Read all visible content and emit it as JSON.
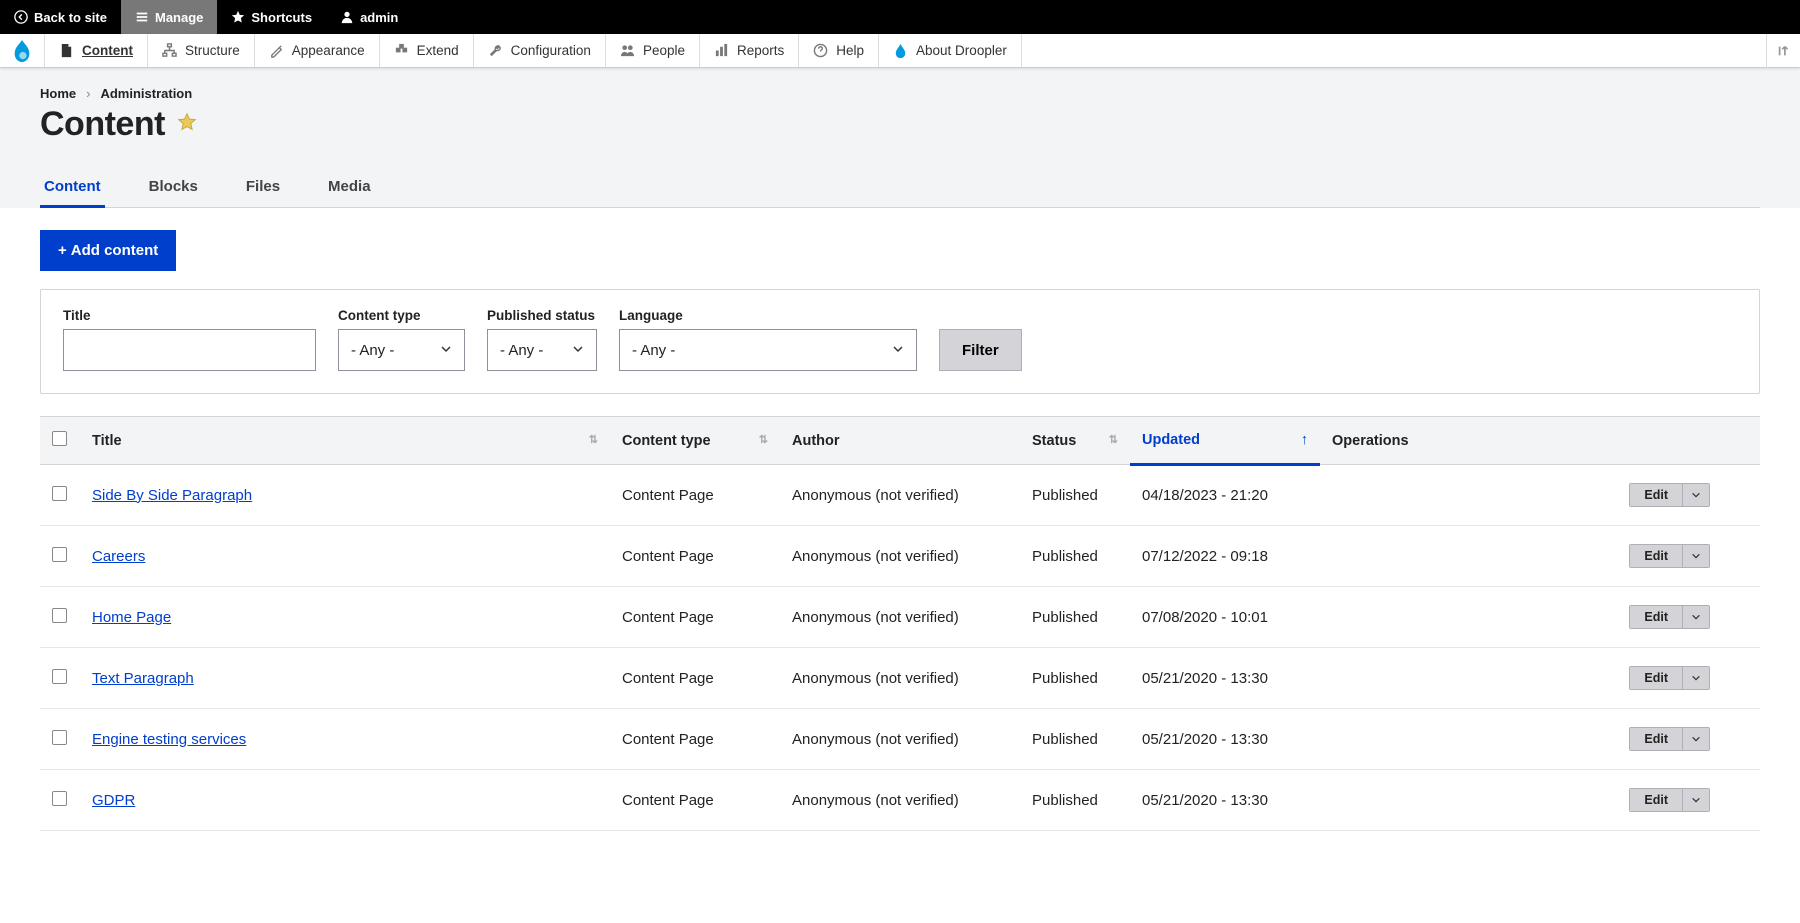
{
  "toolbar_top": {
    "back": "Back to site",
    "manage": "Manage",
    "shortcuts": "Shortcuts",
    "user": "admin"
  },
  "admin_menu": {
    "items": [
      {
        "label": "Content"
      },
      {
        "label": "Structure"
      },
      {
        "label": "Appearance"
      },
      {
        "label": "Extend"
      },
      {
        "label": "Configuration"
      },
      {
        "label": "People"
      },
      {
        "label": "Reports"
      },
      {
        "label": "Help"
      },
      {
        "label": "About Droopler"
      }
    ]
  },
  "breadcrumb": {
    "home": "Home",
    "admin": "Administration"
  },
  "page_title": "Content",
  "tabs": [
    {
      "label": "Content"
    },
    {
      "label": "Blocks"
    },
    {
      "label": "Files"
    },
    {
      "label": "Media"
    }
  ],
  "actions": {
    "add_content": "Add content"
  },
  "filters": {
    "title_label": "Title",
    "title_value": "",
    "ct_label": "Content type",
    "ct_value": "- Any -",
    "ps_label": "Published status",
    "ps_value": "- Any -",
    "lang_label": "Language",
    "lang_value": "- Any -",
    "filter_btn": "Filter"
  },
  "table": {
    "headers": {
      "title": "Title",
      "ct": "Content type",
      "author": "Author",
      "status": "Status",
      "updated": "Updated",
      "ops": "Operations"
    },
    "edit_label": "Edit",
    "rows": [
      {
        "title": "Side By Side Paragraph",
        "ct": "Content Page",
        "author": "Anonymous (not verified)",
        "status": "Published",
        "updated": "04/18/2023 - 21:20"
      },
      {
        "title": "Careers",
        "ct": "Content Page",
        "author": "Anonymous (not verified)",
        "status": "Published",
        "updated": "07/12/2022 - 09:18"
      },
      {
        "title": "Home Page",
        "ct": "Content Page",
        "author": "Anonymous (not verified)",
        "status": "Published",
        "updated": "07/08/2020 - 10:01"
      },
      {
        "title": "Text Paragraph",
        "ct": "Content Page",
        "author": "Anonymous (not verified)",
        "status": "Published",
        "updated": "05/21/2020 - 13:30"
      },
      {
        "title": "Engine testing services",
        "ct": "Content Page",
        "author": "Anonymous (not verified)",
        "status": "Published",
        "updated": "05/21/2020 - 13:30"
      },
      {
        "title": "GDPR",
        "ct": "Content Page",
        "author": "Anonymous (not verified)",
        "status": "Published",
        "updated": "05/21/2020 - 13:30"
      }
    ]
  }
}
